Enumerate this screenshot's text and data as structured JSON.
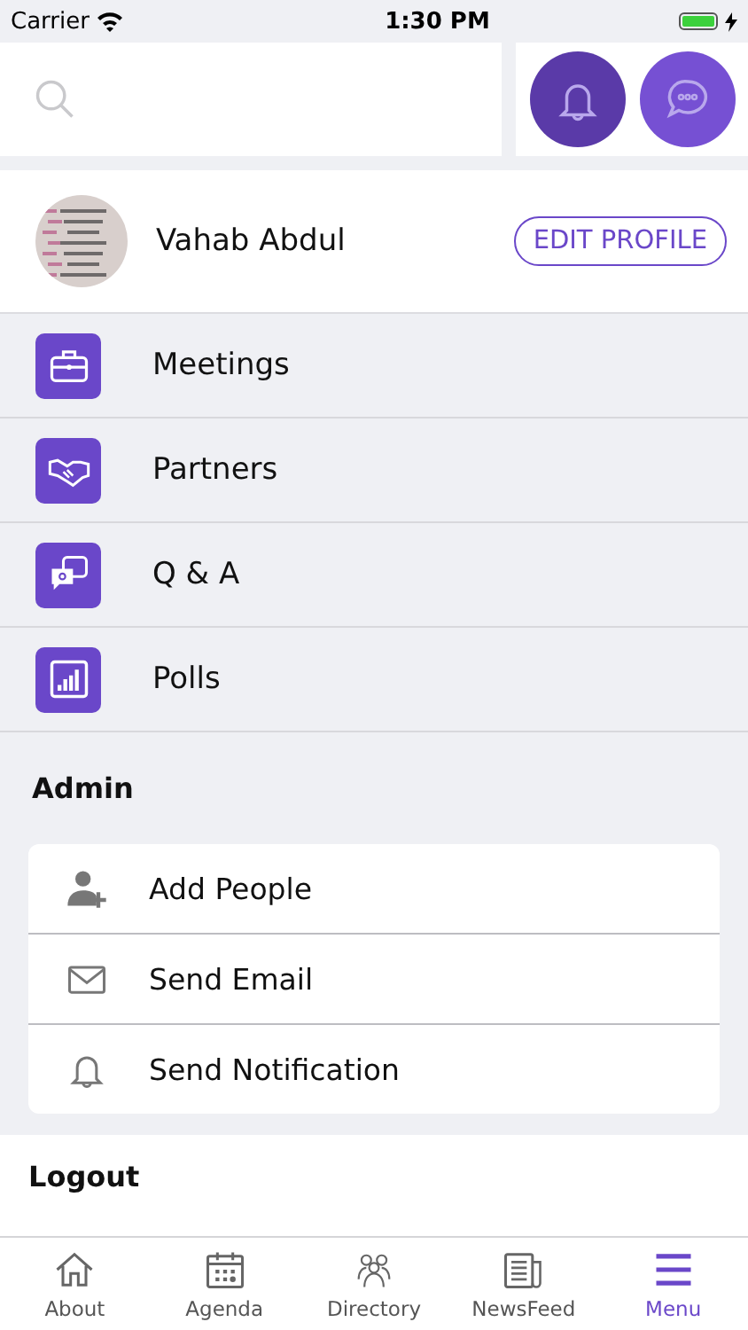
{
  "status_bar": {
    "carrier": "Carrier",
    "time": "1:30 PM"
  },
  "header": {
    "actions": [
      {
        "kind": "bell"
      },
      {
        "kind": "chat"
      }
    ]
  },
  "profile": {
    "name": "Vahab Abdul",
    "edit_button": "EDIT PROFILE"
  },
  "menu": [
    {
      "kind": "briefcase",
      "label": "Meetings"
    },
    {
      "kind": "handshake",
      "label": "Partners"
    },
    {
      "kind": "qa",
      "label": "Q & A"
    },
    {
      "kind": "polls",
      "label": "Polls"
    }
  ],
  "admin": {
    "title": "Admin",
    "items": [
      {
        "kind": "add-person",
        "label": "Add People"
      },
      {
        "kind": "mail",
        "label": "Send Email"
      },
      {
        "kind": "bell",
        "label": "Send Notification"
      }
    ]
  },
  "logout": "Logout",
  "tabs": [
    {
      "kind": "home",
      "label": "About",
      "selected": false
    },
    {
      "kind": "calendar",
      "label": "Agenda",
      "selected": false
    },
    {
      "kind": "people",
      "label": "Directory",
      "selected": false
    },
    {
      "kind": "news",
      "label": "NewsFeed",
      "selected": false
    },
    {
      "kind": "menu",
      "label": "Menu",
      "selected": true
    }
  ]
}
